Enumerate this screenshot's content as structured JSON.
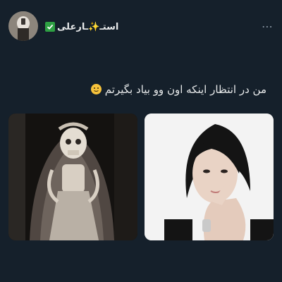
{
  "user": {
    "display_name": "استـ✨ـارعلی",
    "verified_icon": "verified-check-icon"
  },
  "header": {
    "more_label": "⋯"
  },
  "tweet": {
    "text": "من در انتظار اینکه اون وو بیاد بگیرتم",
    "emoji_icon": "slightly-smiling-face-icon"
  },
  "media": [
    {
      "icon": "skeleton-bride-photo"
    },
    {
      "icon": "young-man-portrait-photo"
    }
  ],
  "colors": {
    "background": "#15202b",
    "text": "#e7e9ea",
    "verified": "#2ea043",
    "muted": "#8b98a5"
  }
}
